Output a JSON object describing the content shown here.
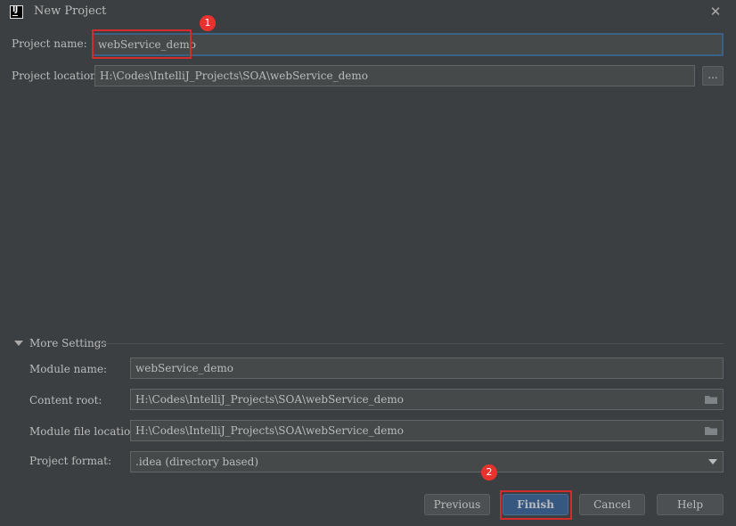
{
  "window": {
    "title": "New Project",
    "app_icon_text": "IJ",
    "close_glyph": "✕"
  },
  "form": {
    "project_name_label": "Project name:",
    "project_name_value": "webService_demo",
    "project_location_label": "Project location:",
    "project_location_value": "H:\\Codes\\IntelliJ_Projects\\SOA\\webService_demo",
    "browse_label": "..."
  },
  "more_settings": {
    "toggle_label": "More Settings",
    "module_name_label": "Module name:",
    "module_name_value": "webService_demo",
    "content_root_label": "Content root:",
    "content_root_value": "H:\\Codes\\IntelliJ_Projects\\SOA\\webService_demo",
    "module_file_location_label": "Module file location:",
    "module_file_location_value": "H:\\Codes\\IntelliJ_Projects\\SOA\\webService_demo",
    "project_format_label": "Project format:",
    "project_format_value": ".idea (directory based)"
  },
  "buttons": {
    "previous": "Previous",
    "finish": "Finish",
    "cancel": "Cancel",
    "help": "Help"
  },
  "annotations": {
    "marker_1": "1",
    "marker_2": "2"
  },
  "colors": {
    "background": "#3c3f41",
    "field": "#45494a",
    "focus_border": "#3d6185",
    "primary_button": "#365880",
    "annotation_red": "#e8322d"
  },
  "icons": [
    "app-logo-icon",
    "close-icon",
    "expand-triangle-icon",
    "folder-icon",
    "dropdown-arrow-icon"
  ]
}
